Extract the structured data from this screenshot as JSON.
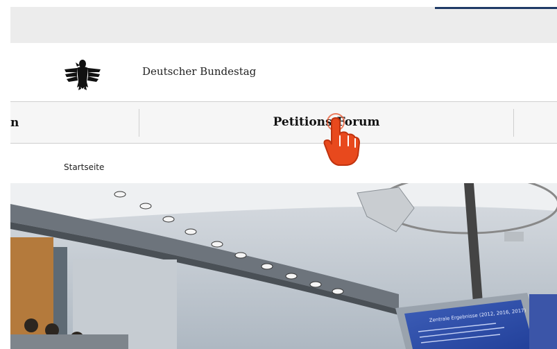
{
  "brand": {
    "name": "Deutscher Bundestag",
    "logo_icon": "federal-eagle-icon"
  },
  "nav": {
    "prev_tab_fragment": "n",
    "current_tab": "Petitions-Forum"
  },
  "breadcrumb": {
    "home": "Startseite"
  },
  "hero": {
    "slide_title": "Zentrale Ergebnisse (2012, 2016, 2017)"
  },
  "colors": {
    "topbar": "#ececec",
    "accent": "#1f3a66",
    "cursor": "#e8491d"
  }
}
